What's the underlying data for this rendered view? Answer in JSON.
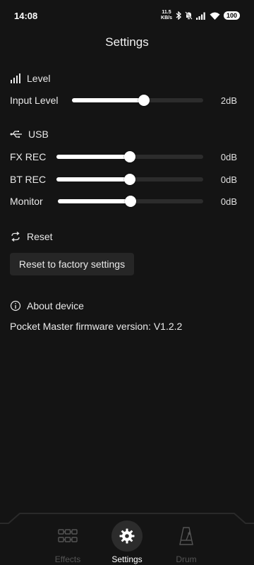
{
  "status_bar": {
    "time": "14:08",
    "net_speed_value": "11.5",
    "net_speed_unit": "KB/s",
    "battery": "100"
  },
  "header": {
    "title": "Settings"
  },
  "level_section": {
    "title": "Level",
    "icon": "signal-bars-icon",
    "sliders": [
      {
        "label": "Input Level",
        "value": "2dB",
        "position": 0.55
      }
    ]
  },
  "usb_section": {
    "title": "USB",
    "icon": "usb-icon",
    "sliders": [
      {
        "label": "FX REC",
        "value": "0dB",
        "position": 0.5
      },
      {
        "label": "BT REC",
        "value": "0dB",
        "position": 0.5
      },
      {
        "label": "Monitor",
        "value": "0dB",
        "position": 0.5
      }
    ]
  },
  "reset_section": {
    "title": "Reset",
    "icon": "refresh-icon",
    "button_label": "Reset to factory settings"
  },
  "about_section": {
    "title": "About device",
    "icon": "info-icon",
    "firmware_text": "Pocket Master firmware version: V1.2.2"
  },
  "bottom_nav": {
    "items": [
      {
        "label": "Effects",
        "icon": "effects-chain-icon",
        "active": false
      },
      {
        "label": "Settings",
        "icon": "gear-icon",
        "active": true
      },
      {
        "label": "Drum",
        "icon": "metronome-icon",
        "active": false
      }
    ]
  },
  "colors": {
    "background": "#141414",
    "track": "#2c2c2c",
    "fill": "#ffffff",
    "inactive_nav": "#555555"
  }
}
